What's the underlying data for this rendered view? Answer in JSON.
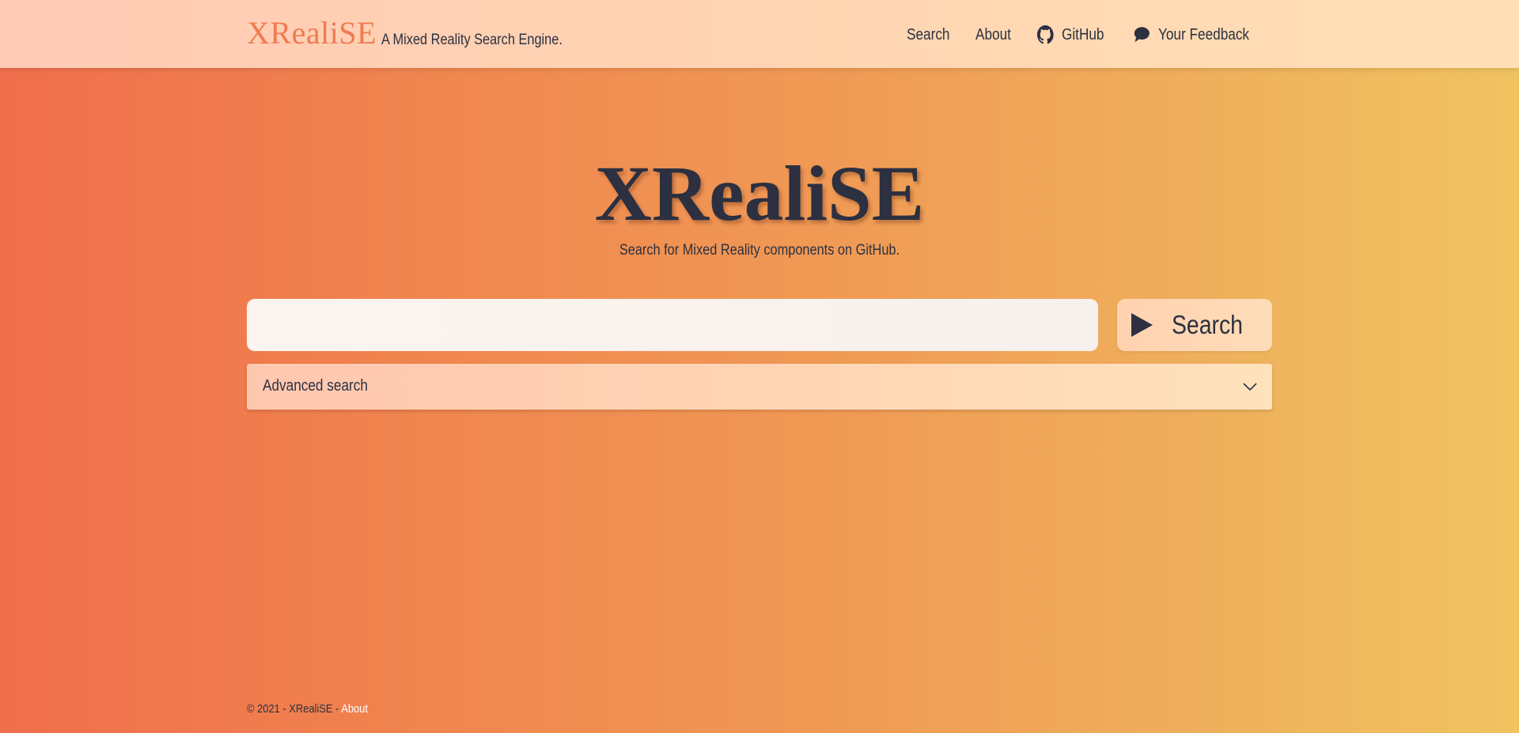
{
  "header": {
    "brand": "XRealiSE",
    "tagline": "A Mixed Reality Search Engine.",
    "nav": {
      "search": "Search",
      "about": "About",
      "github": "GitHub",
      "feedback": "Your Feedback"
    }
  },
  "hero": {
    "title": "XRealiSE",
    "subtitle": "Search for Mixed Reality components on GitHub."
  },
  "search": {
    "value": "",
    "placeholder": "",
    "button_label": "Search"
  },
  "advanced": {
    "label": "Advanced search"
  },
  "footer": {
    "prefix": "© 2021 - XRealiSE - ",
    "link": "About"
  },
  "colors": {
    "brand_accent": "#f07a50",
    "text_dark": "#2c3040"
  },
  "icons": {
    "github": "github-icon",
    "feedback": "comment-icon",
    "search_button": "play-icon",
    "advanced_toggle": "chevron-down-icon"
  }
}
